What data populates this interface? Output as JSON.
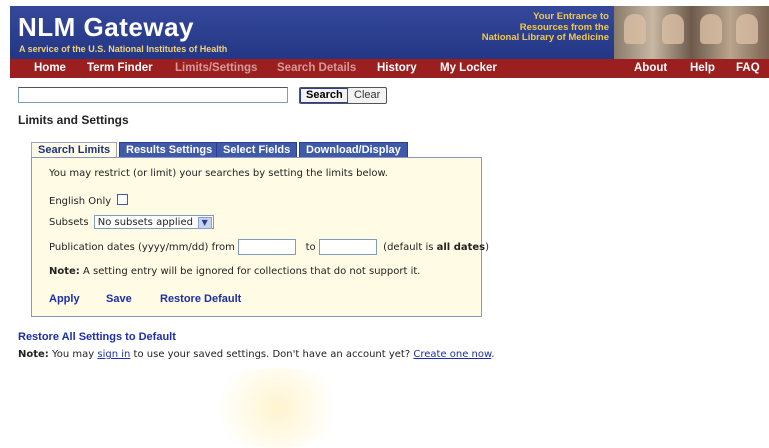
{
  "header": {
    "title": "NLM Gateway",
    "subtitle": "A service of the U.S. National Institutes of Health",
    "tagline_line1": "Your Entrance to",
    "tagline_line2": "Resources from the",
    "tagline_line3": "National Library of Medicine"
  },
  "nav": {
    "items": [
      {
        "label": "Home",
        "enabled": true
      },
      {
        "label": "Term Finder",
        "enabled": true
      },
      {
        "label": "Limits/Settings",
        "enabled": false
      },
      {
        "label": "Search Details",
        "enabled": false
      },
      {
        "label": "History",
        "enabled": true
      },
      {
        "label": "My Locker",
        "enabled": true
      },
      {
        "label": "About",
        "enabled": true
      },
      {
        "label": "Help",
        "enabled": true
      },
      {
        "label": "FAQ",
        "enabled": true
      }
    ]
  },
  "search": {
    "value": "",
    "search_label": "Search",
    "clear_label": "Clear"
  },
  "page": {
    "title": "Limits and Settings"
  },
  "tabs": [
    {
      "label": "Search Limits",
      "active": true
    },
    {
      "label": "Results Settings",
      "active": false
    },
    {
      "label": "Select Fields",
      "active": false
    },
    {
      "label": "Download/Display",
      "active": false
    }
  ],
  "panel": {
    "intro": "You may restrict (or limit) your searches by setting the limits below.",
    "english_only_label": "English Only",
    "english_only_checked": false,
    "subsets_label": "Subsets",
    "subsets_selected": "No subsets applied",
    "pubdates_label": "Publication dates (yyyy/mm/dd) from",
    "pubdates_to": "to",
    "pubdates_from_value": "",
    "pubdates_to_value": "",
    "pubdates_default_prefix": "(default is",
    "pubdates_default_value": "all dates",
    "pubdates_default_suffix": ")",
    "note_label": "Note:",
    "note_text": "A setting entry will be ignored for collections that do not support it.",
    "apply_label": "Apply",
    "save_label": "Save",
    "restore_default_label": "Restore Default"
  },
  "footer": {
    "restore_all_label": "Restore All Settings to Default",
    "note_label": "Note:",
    "note_part1": "You may",
    "sign_in_link": "sign in",
    "note_part2": "to use your saved settings. Don't have an account yet?",
    "create_link": "Create one now",
    "note_end": "."
  },
  "colors": {
    "header_bg": "#2a3e8f",
    "nav_bg": "#9b1f1f",
    "panel_bg": "#fffbe4",
    "link": "#1c2fa8"
  }
}
